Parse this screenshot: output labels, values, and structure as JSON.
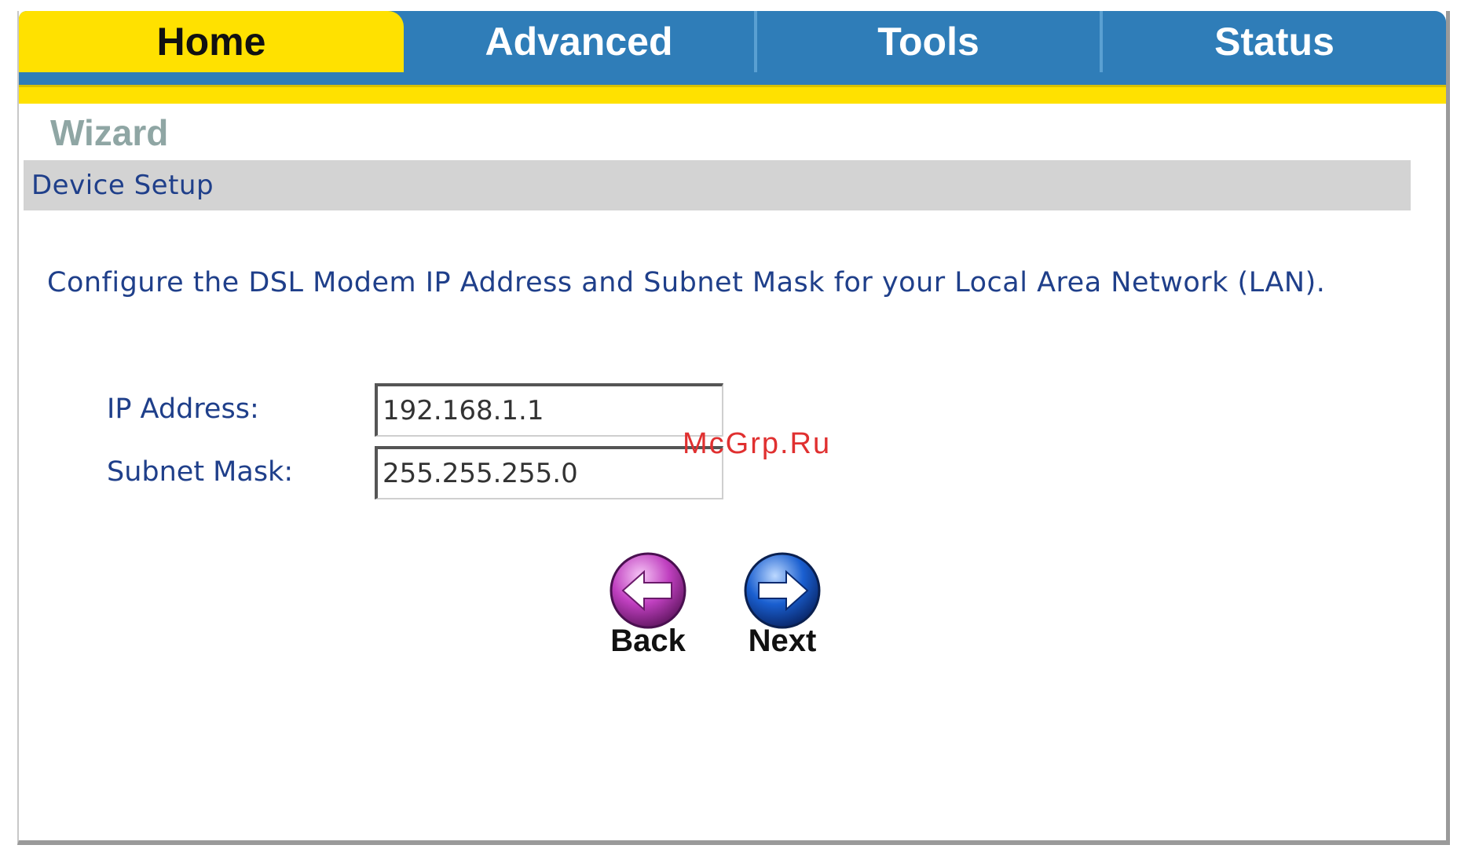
{
  "tabs": {
    "home": "Home",
    "advanced": "Advanced",
    "tools": "Tools",
    "status": "Status"
  },
  "page": {
    "title": "Wizard",
    "section": "Device Setup",
    "instruction": "Configure the DSL Modem IP Address and Subnet Mask for your Local Area Network (LAN)."
  },
  "form": {
    "ip_label": "IP Address:",
    "ip_value": "192.168.1.1",
    "mask_label": "Subnet Mask:",
    "mask_value": "255.255.255.0"
  },
  "buttons": {
    "back": "Back",
    "next": "Next"
  },
  "watermark": "McGrp.Ru",
  "colors": {
    "tab_active": "#ffe100",
    "tab_inactive": "#2f7db8",
    "text_blue": "#1f3f8a",
    "back_button": "#c040c0",
    "next_button": "#1a5fd0"
  },
  "icons": {
    "back": "arrow-left-icon",
    "next": "arrow-right-icon"
  }
}
